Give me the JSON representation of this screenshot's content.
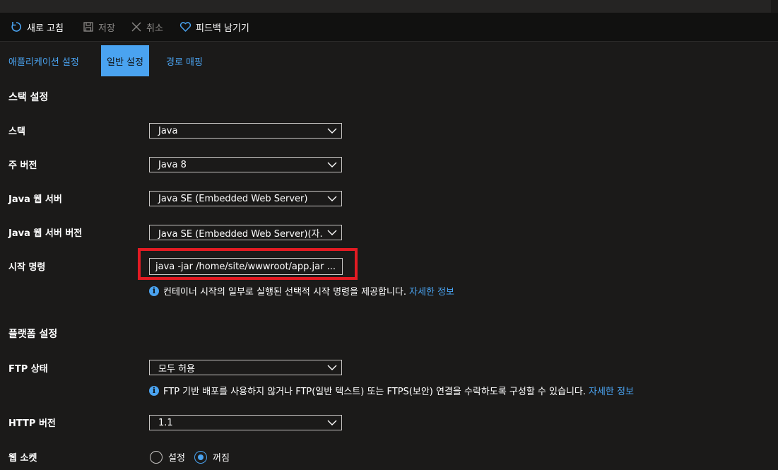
{
  "toolbar": {
    "refresh_label": "새로 고침",
    "save_label": "저장",
    "cancel_label": "취소",
    "feedback_label": "피드백 남기기"
  },
  "tabs": [
    {
      "label": "애플리케이션 설정",
      "active": false
    },
    {
      "label": "일반 설정",
      "active": true
    },
    {
      "label": "경로 매핑",
      "active": false
    }
  ],
  "stack_settings": {
    "section_title": "스택 설정",
    "stack": {
      "label": "스택",
      "value": "Java"
    },
    "major_version": {
      "label": "주 버전",
      "value": "Java 8"
    },
    "java_web_server": {
      "label": "Java 웹 서버",
      "value": "Java SE (Embedded Web Server)"
    },
    "java_web_server_version": {
      "label": "Java 웹 서버 버전",
      "value": "Java SE (Embedded Web Server)(자..."
    },
    "startup_command": {
      "label": "시작 명령",
      "value": "java -jar /home/site/wwwroot/app.jar ...",
      "info": "컨테이너 시작의 일부로 실행된 선택적 시작 명령을 제공합니다.",
      "link": "자세한 정보"
    }
  },
  "platform_settings": {
    "section_title": "플랫폼 설정",
    "ftp_state": {
      "label": "FTP 상태",
      "value": "모두 허용",
      "info": "FTP 기반 배포를 사용하지 않거나 FTP(일반 텍스트) 또는 FTPS(보안) 연결을 수락하도록 구성할 수 있습니다.",
      "link": "자세한 정보"
    },
    "http_version": {
      "label": "HTTP 버전",
      "value": "1.1"
    },
    "web_sockets": {
      "label": "웹 소켓",
      "options": [
        {
          "label": "설정",
          "checked": false
        },
        {
          "label": "꺼짐",
          "checked": true
        }
      ]
    }
  },
  "colors": {
    "accent": "#4aa3f0",
    "highlight": "#e31b23",
    "background": "#1b1a19"
  }
}
